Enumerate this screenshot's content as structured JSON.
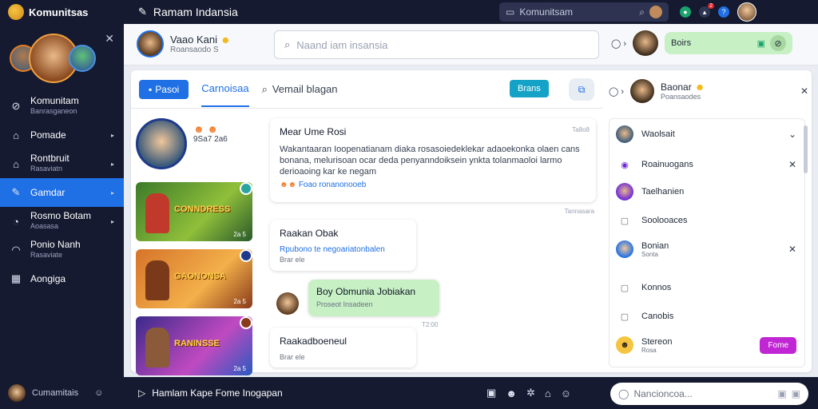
{
  "colors": {
    "accent": "#1f6fe5",
    "sidebar_bg": "#151a30",
    "green_bubble": "#c8f0c5",
    "follow": "#c026d3"
  },
  "topbar": {
    "brand": "Komunitsas",
    "chat_title": "Ramam Indansia",
    "search_label": "Komunitsam"
  },
  "sidebar": {
    "items": [
      {
        "label": "Komunitam",
        "sub": "Banrasganeon",
        "icon": "compass-icon"
      },
      {
        "label": "Pomade",
        "sub": "",
        "icon": "home-icon"
      },
      {
        "label": "Rontbruit",
        "sub": "Rasaviatn",
        "icon": "house-icon"
      },
      {
        "label": "Gamdar",
        "sub": "",
        "icon": "edit-icon"
      },
      {
        "label": "Rosmo Botam",
        "sub": "Aoasasa",
        "icon": "gauge-icon"
      },
      {
        "label": "Ponio Nanh",
        "sub": "Rasaviate",
        "icon": "dome-icon"
      },
      {
        "label": "Aongiga",
        "sub": "",
        "icon": "grid-icon"
      }
    ]
  },
  "header": {
    "user_name": "Vaao Kani",
    "user_sub": "Roansaodo S",
    "search_placeholder": "Naand iam insansia",
    "green_label": "Boirs"
  },
  "tabs": {
    "active": "Pasoi",
    "second": "Carnoisaa",
    "third": "Vemail blagan",
    "button": "Brans",
    "right_name": "Baonar",
    "right_sub": "Poansaodes"
  },
  "posts": {
    "meta": "9Sa7 2a6",
    "games": [
      {
        "title": "CONNDRESS",
        "meta": "2a 5"
      },
      {
        "title": "GAONONSA",
        "meta": "2a 5"
      },
      {
        "title": "RANINSSE",
        "meta": "2a 5"
      }
    ]
  },
  "chat": {
    "msg1": {
      "title": "Mear Ume Rosi",
      "text": "Wakantaaran Ioopenatianam diaka rosasoiedeklekar adaoekonka olaen cans bonana, melurisoan ocar deda penyanndoiksein ynkta tolanmaoloi larmo derioaoing kar ke negam",
      "link": "Foao ronanonooeb",
      "time": "Ta8o8"
    },
    "msg1_time": "Tannasara",
    "msg2": {
      "title": "Raakan Obak",
      "link": "Rpubono te negoariatonbalen",
      "sub": "Brar ele"
    },
    "msg3": {
      "title": "Boy Obmunia Jobiakan",
      "sub": "Proseot Insadeen",
      "time": "T2:00"
    },
    "msg4": {
      "title": "Raakadboeneul",
      "sub": "Brar ele"
    }
  },
  "right_list": [
    {
      "label": "Waolsait",
      "sub": "",
      "icon": "avatar-icon",
      "close": "chevron"
    },
    {
      "label": "Roainuogans",
      "sub": "",
      "icon": "circle-icon",
      "close": "x"
    },
    {
      "label": "Taelhanien",
      "sub": "",
      "icon": "avatar-icon",
      "close": ""
    },
    {
      "label": "Soolooaces",
      "sub": "",
      "icon": "square-icon",
      "close": ""
    },
    {
      "label": "Bonian",
      "sub": "Sonta",
      "icon": "avatar-icon",
      "close": "x"
    },
    {
      "label": "Konnos",
      "sub": "",
      "icon": "square-icon",
      "close": ""
    },
    {
      "label": "Canobis",
      "sub": "",
      "icon": "square-icon",
      "close": ""
    },
    {
      "label": "Stereon",
      "sub": "Rosa",
      "icon": "smiley-icon",
      "close": ""
    }
  ],
  "follow_label": "Fome",
  "bottom": {
    "user": "Cumamitais",
    "message": "Hamlam Kape Fome Inogapan",
    "input_placeholder": "Nancioncoa..."
  }
}
